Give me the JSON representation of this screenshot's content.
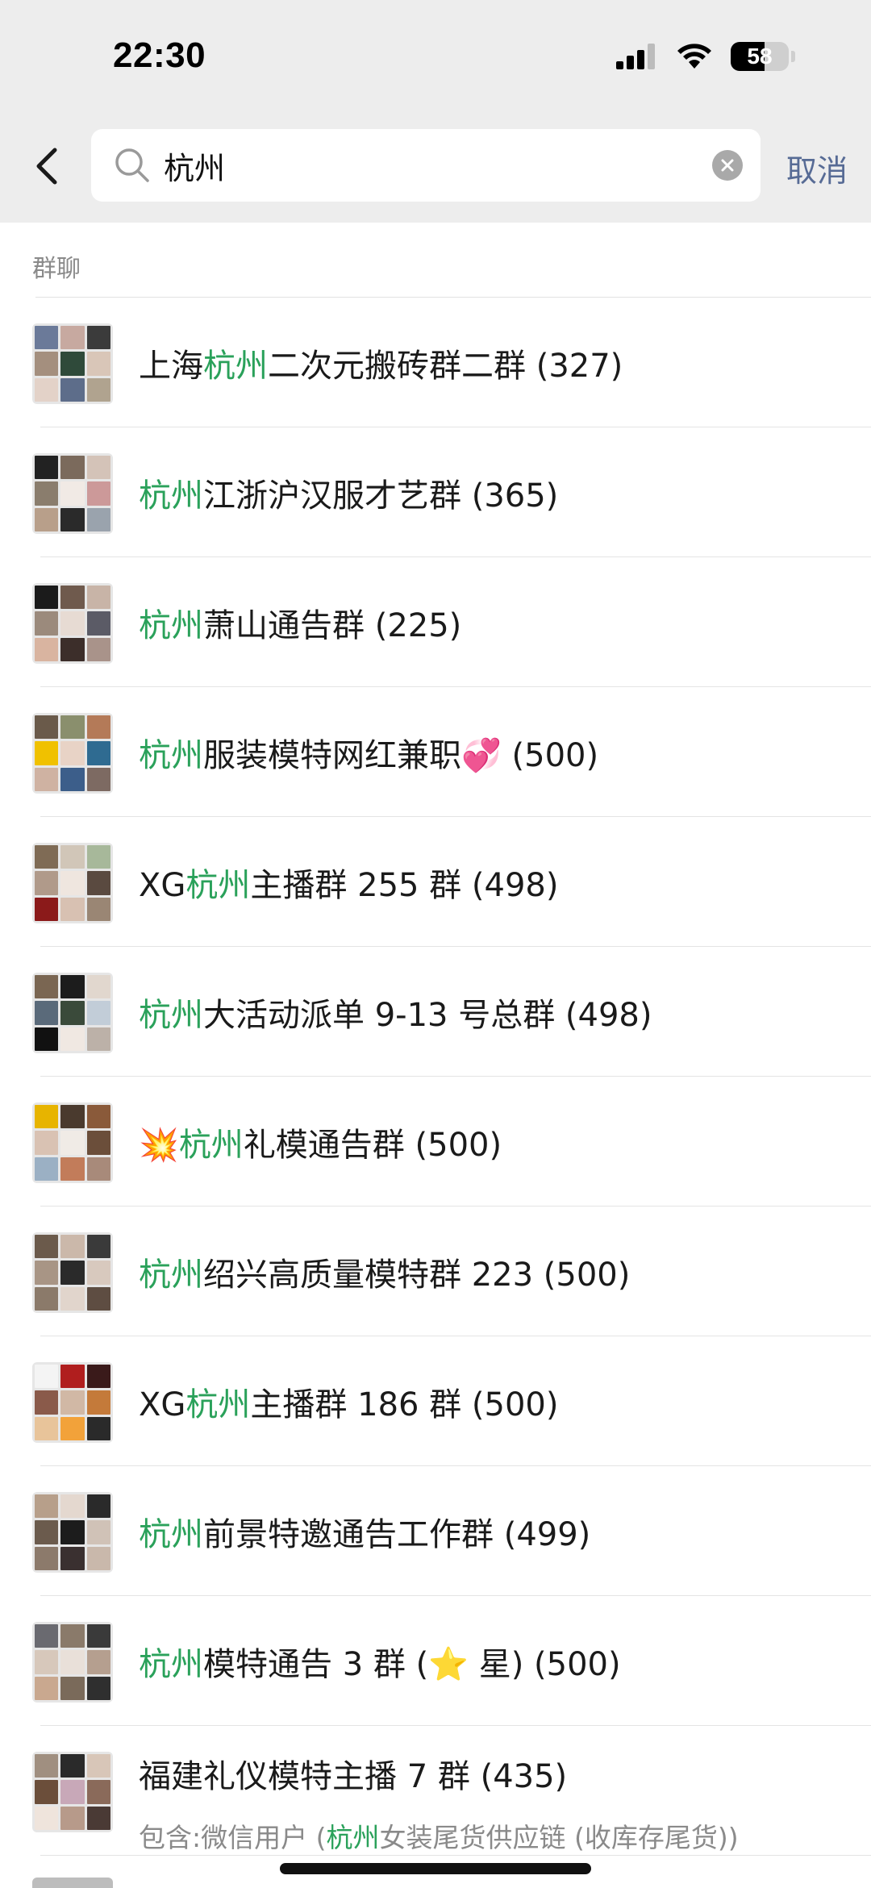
{
  "status_bar": {
    "time": "22:30",
    "battery": "58",
    "battery_level": 0.58
  },
  "search": {
    "query": "杭州",
    "cancel_label": "取消"
  },
  "section": {
    "title": "群聊"
  },
  "results": [
    {
      "pre": "上海",
      "hl": "杭州",
      "post": "二次元搬砖群二群 (327)",
      "sub": null,
      "colors": [
        "#6b7a99",
        "#c7a9a0",
        "#3b3b3b",
        "#a48f7e",
        "#2f4a3a",
        "#d9c6b8",
        "#e3d2c8",
        "#5d6d8a",
        "#b0a38f"
      ]
    },
    {
      "pre": "",
      "hl": "杭州",
      "post": "江浙沪汉服才艺群 (365)",
      "sub": null,
      "colors": [
        "#222",
        "#7b6a5c",
        "#d4c3b8",
        "#8a7d6d",
        "#f1eae5",
        "#c99",
        "#b89f8a",
        "#2a2a2a",
        "#9aa3ad"
      ]
    },
    {
      "pre": "",
      "hl": "杭州",
      "post": "萧山通告群 (225)",
      "sub": null,
      "colors": [
        "#1b1b1b",
        "#6f5a4d",
        "#c8b4a7",
        "#9b8a7c",
        "#e7dbd3",
        "#5b5b66",
        "#d9b4a0",
        "#3c2e2a",
        "#a9938a"
      ]
    },
    {
      "pre": "",
      "hl": "杭州",
      "post": "服装模特网红兼职💞 (500)",
      "sub": null,
      "colors": [
        "#6a5a4a",
        "#8a8f6d",
        "#b47a58",
        "#f0c100",
        "#e8d3c6",
        "#2f6b91",
        "#cfb2a2",
        "#3c5e8a",
        "#7d6a62"
      ]
    },
    {
      "pre": "XG",
      "hl": "杭州",
      "post": "主播群 255 群 (498)",
      "sub": null,
      "colors": [
        "#7f6b55",
        "#d1c6b8",
        "#a7b89a",
        "#b09a8a",
        "#efe6df",
        "#5a4a40",
        "#8b1a1a",
        "#d8c1b2",
        "#9a8674"
      ]
    },
    {
      "pre": "",
      "hl": "杭州",
      "post": "大活动派单 9-13 号总群 (498)",
      "sub": null,
      "colors": [
        "#7a6652",
        "#1c1c1c",
        "#e1d7ce",
        "#5a6a7a",
        "#3a4a3a",
        "#c2cdd8",
        "#111",
        "#f0e8e2",
        "#bcb1a8"
      ]
    },
    {
      "pre": "💥",
      "hl": "杭州",
      "post": "礼模通告群 (500)",
      "sub": null,
      "colors": [
        "#e7b400",
        "#4a3a2e",
        "#8a5a3a",
        "#d9c2b3",
        "#f0ebe6",
        "#6b4e3a",
        "#9bb0c4",
        "#c27c5a",
        "#a88a7a"
      ]
    },
    {
      "pre": "",
      "hl": "杭州",
      "post": "绍兴高质量模特群 223 (500)",
      "sub": null,
      "colors": [
        "#6b5a4b",
        "#cbb8aa",
        "#3a3a3a",
        "#a89585",
        "#2a2a2a",
        "#d8c9be",
        "#8b7a6a",
        "#e1d5cc",
        "#5e4d42"
      ]
    },
    {
      "pre": "XG",
      "hl": "杭州",
      "post": "主播群 186 群 (500)",
      "sub": null,
      "colors": [
        "#f4f4f4",
        "#b01e1e",
        "#3a1a1a",
        "#8a5a4a",
        "#d1b8a5",
        "#c47a3a",
        "#e8c49a",
        "#f2a23a",
        "#2a2a2a"
      ]
    },
    {
      "pre": "",
      "hl": "杭州",
      "post": "前景特邀通告工作群 (499)",
      "sub": null,
      "colors": [
        "#b79f8a",
        "#e4d8cf",
        "#2a2a2a",
        "#6b5b4d",
        "#1c1c1c",
        "#d0c2b7",
        "#8c7a6b",
        "#3a3030",
        "#c9b8ab"
      ]
    },
    {
      "pre": "",
      "hl": "杭州",
      "post": "模特通告 3 群 (⭐ 星) (500)",
      "sub": null,
      "colors": [
        "#6a6a70",
        "#8a7a6a",
        "#3a3a3a",
        "#d7c8bb",
        "#e9e0d9",
        "#b59f8f",
        "#c9a88f",
        "#7a6a5a",
        "#2f2f2f"
      ]
    },
    {
      "pre": "",
      "hl": "",
      "post": "福建礼仪模特主播 7 群 (435)",
      "sub": {
        "pre": "包含:微信用户 (",
        "hl": "杭州",
        "post": "女装尾货供应链 (收库存尾货))"
      },
      "colors": [
        "#a08f80",
        "#2a2a2a",
        "#d8c6b8",
        "#6b4e3a",
        "#c8a8b8",
        "#8a6a5a",
        "#efe4dc",
        "#b79a8a",
        "#4a3a35"
      ]
    }
  ]
}
